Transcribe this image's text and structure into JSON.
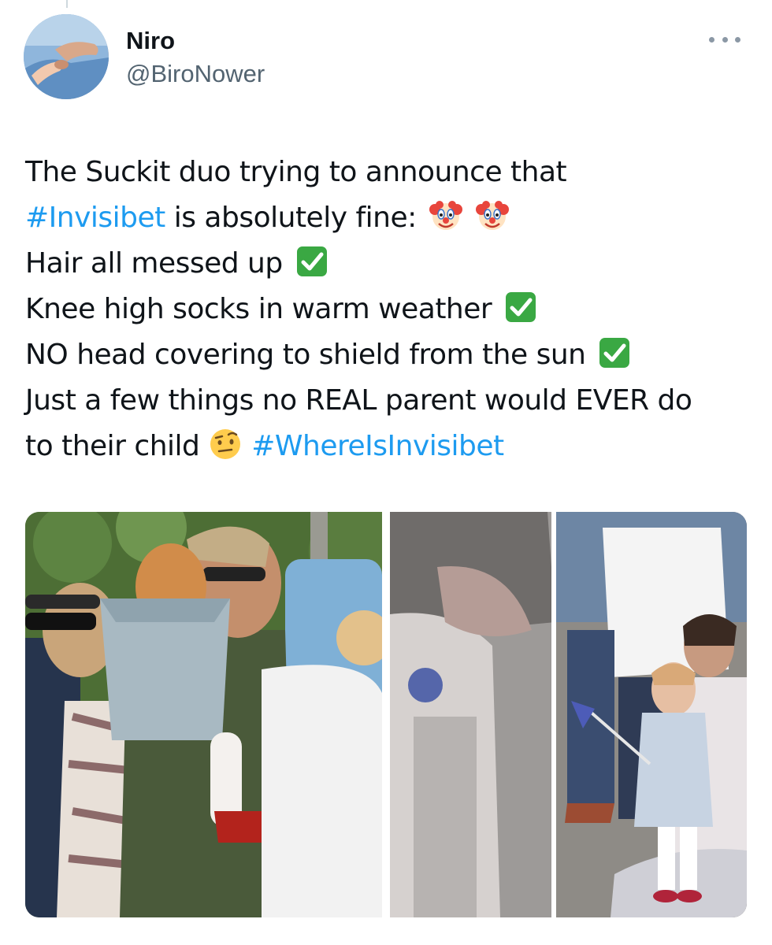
{
  "author": {
    "display_name": "Niro",
    "handle": "@BiroNower",
    "avatar_icon": "hands-avatar-icon"
  },
  "actions": {
    "more_icon": "more-dots-icon"
  },
  "tweet": {
    "lines": [
      {
        "segments": [
          {
            "text": "The Suckit duo trying to announce that",
            "type": "text"
          }
        ]
      },
      {
        "segments": [
          {
            "text": "#Invisibet",
            "type": "hashtag"
          },
          {
            "text": " is absolutely fine:",
            "type": "text"
          }
        ],
        "emojis": [
          "clown-face-emoji",
          "clown-face-emoji"
        ]
      },
      {
        "segments": [
          {
            "text": "Hair all messed up",
            "type": "text"
          }
        ],
        "emojis": [
          "check-mark-emoji"
        ]
      },
      {
        "segments": [
          {
            "text": "Knee high socks in warm weather",
            "type": "text"
          }
        ],
        "emojis": [
          "check-mark-emoji"
        ]
      },
      {
        "segments": [
          {
            "text": "NO head covering to shield from the sun",
            "type": "text"
          }
        ],
        "emojis": [
          "check-mark-emoji"
        ]
      },
      {
        "segments": [
          {
            "text": "Just a few things no REAL parent would EVER do",
            "type": "text"
          }
        ]
      },
      {
        "segments": [
          {
            "text": "to their child ",
            "type": "text"
          }
        ],
        "emojis": [
          "raised-eyebrow-face-emoji"
        ],
        "trailing": {
          "text": " #WhereIsInvisibet",
          "type": "hashtag"
        }
      }
    ]
  },
  "colors": {
    "hashtag": "#1d9bf0",
    "text": "#0f1419",
    "muted": "#536471"
  },
  "media": [
    {
      "name": "photo-left",
      "icon": "photo-icon"
    },
    {
      "name": "photo-right",
      "icon": "photo-icon"
    }
  ]
}
